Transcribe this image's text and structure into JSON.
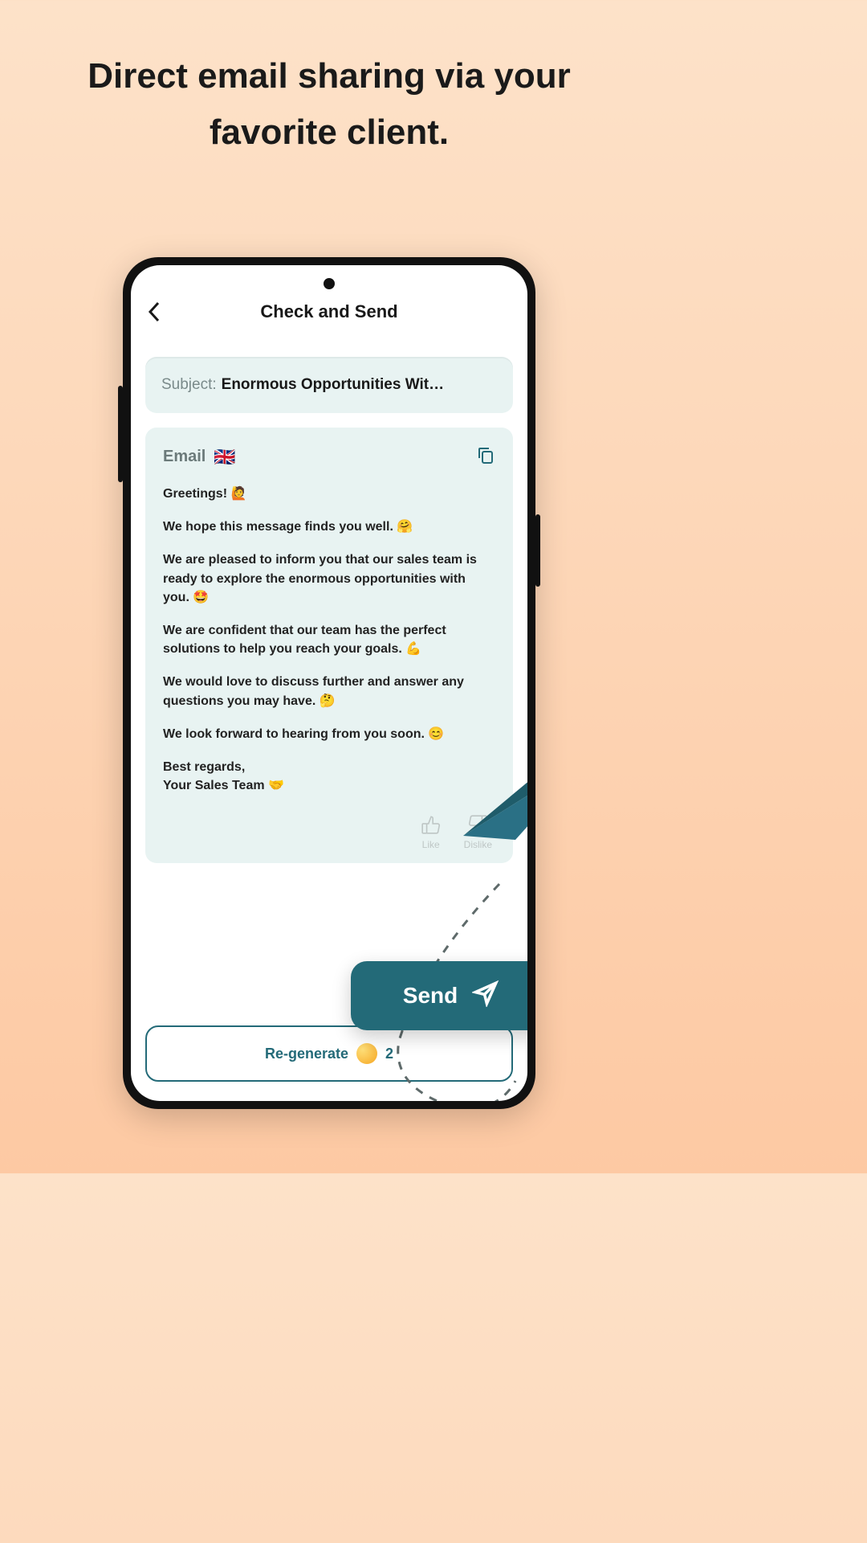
{
  "headline": "Direct email sharing via your favorite client.",
  "header": {
    "title": "Check and Send"
  },
  "subject": {
    "label": "Subject:",
    "value": "Enormous Opportunities Wit…"
  },
  "email": {
    "label": "Email",
    "flag": "🇬🇧",
    "paragraphs": [
      "Greetings! 🙋",
      "We hope this message finds you well. 🤗",
      "We are pleased to inform you that our sales team is ready to explore the enormous opportunities with you. 🤩",
      "We are confident that our team has the perfect solutions to help you reach your goals. 💪",
      "We would love to discuss further and answer any questions you may have. 🤔",
      "We look forward to hearing from you soon. 😊",
      "Best regards,\nYour Sales Team 🤝"
    ]
  },
  "feedback": {
    "like": "Like",
    "dislike": "Dislike"
  },
  "actions": {
    "regenerate": "Re-generate",
    "regen_count": "2",
    "send": "Send"
  }
}
